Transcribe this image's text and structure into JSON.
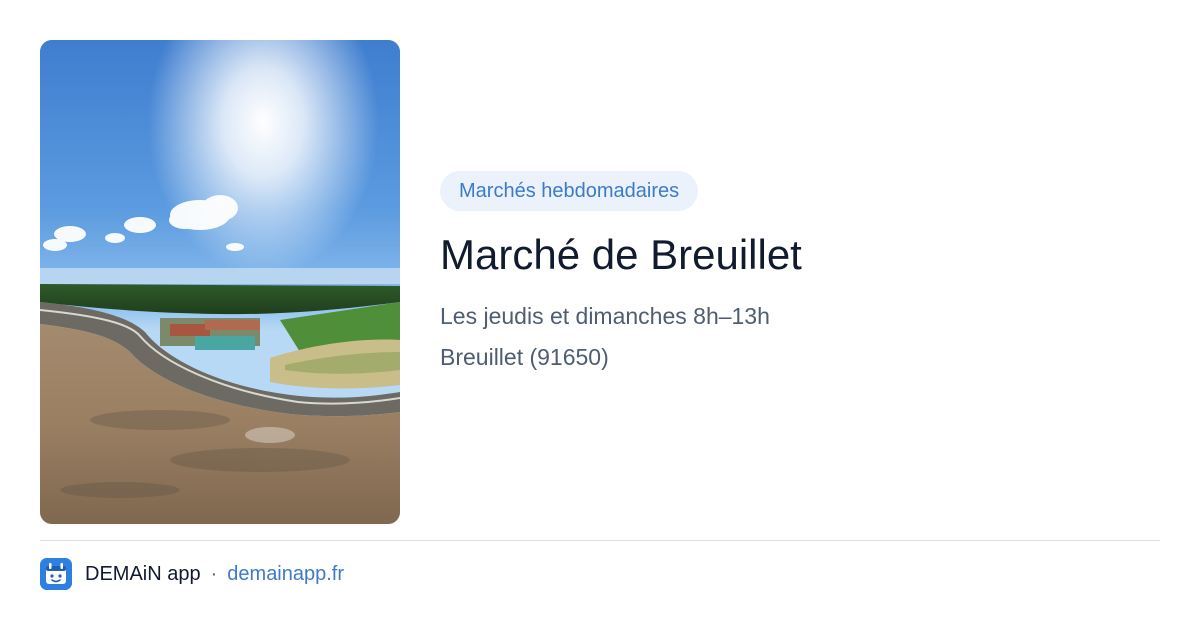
{
  "photo": {
    "description_icon": "aerial-panorama-image",
    "sky_color": "#4f8fd8",
    "sand_color": "#9a8268"
  },
  "content": {
    "category": "Marchés hebdomadaires",
    "title": "Marché de Breuillet",
    "schedule": "Les jeudis et dimanches 8h–13h",
    "location": "Breuillet (91650)"
  },
  "footer": {
    "app_icon": "demain-app-icon",
    "app_name": "DEMAiN app",
    "separator": "·",
    "site": "demainapp.fr"
  },
  "colors": {
    "accent": "#3d7bc9",
    "tag_bg": "#ebf2fb",
    "title": "#111a2e",
    "meta": "#4f5d72"
  }
}
